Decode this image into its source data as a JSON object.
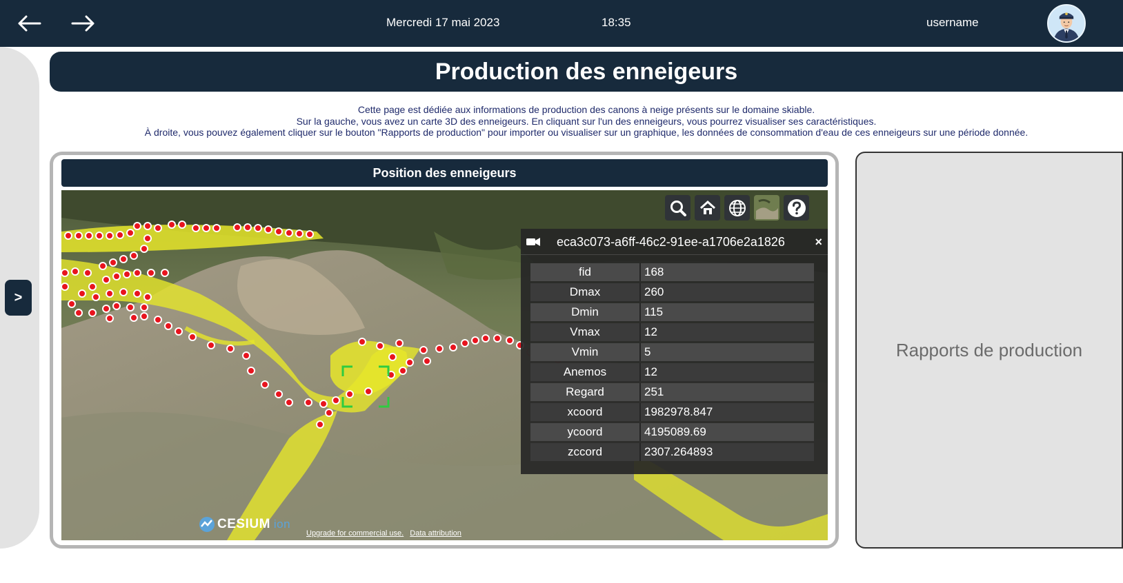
{
  "header": {
    "back_icon": "arrow-left-icon",
    "forward_icon": "arrow-right-icon",
    "date": "Mercredi 17 mai 2023",
    "time": "18:35",
    "username": "username",
    "avatar_icon": "user-avatar-icon"
  },
  "sidebar": {
    "toggle_label": ">"
  },
  "page": {
    "title": "Production des enneigeurs",
    "intro": [
      "Cette page est dédiée aux informations de production des canons à neige présents sur le domaine skiable.",
      "Sur la gauche, vous avez un carte 3D des enneigeurs. En cliquant sur l'un des enneigeurs, vous pourrez visualiser ses caractéristiques.",
      "À droite, vous pouvez également cliquer sur le bouton \"Rapports de production\" pour importer ou visualiser sur un graphique, les données de consommation d'eau de ces enneigeurs sur une période donnée."
    ]
  },
  "map": {
    "header": "Position des enneigeurs",
    "toolbar": [
      "search-icon",
      "home-icon",
      "globe-icon",
      "imagery-layer-icon",
      "help-icon"
    ],
    "infobox": {
      "title": "eca3c073-a6ff-46c2-91ee-a1706e2a1826",
      "close": "×",
      "rows": [
        {
          "key": "fid",
          "value": "168"
        },
        {
          "key": "Dmax",
          "value": "260"
        },
        {
          "key": "Dmin",
          "value": "115"
        },
        {
          "key": "Vmax",
          "value": "12"
        },
        {
          "key": "Vmin",
          "value": "5"
        },
        {
          "key": "Anemos",
          "value": "12"
        },
        {
          "key": "Regard",
          "value": "251"
        },
        {
          "key": "xcoord",
          "value": "1982978.847"
        },
        {
          "key": "ycoord",
          "value": "4195089.69"
        },
        {
          "key": "zccord",
          "value": "2307.264893"
        }
      ]
    },
    "logo_text": "CESIUM",
    "logo_suffix": "ion",
    "credits": [
      "Upgrade for commercial use.",
      "Data attribution"
    ]
  },
  "reports": {
    "label": "Rapports de production"
  },
  "colors": {
    "navy": "#172a3c",
    "marker": "#e8141e",
    "trail": "#e6e62a",
    "panel": "#e3e3e3"
  }
}
